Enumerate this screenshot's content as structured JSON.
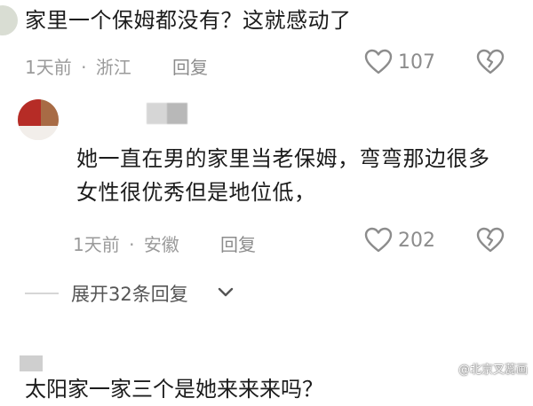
{
  "comment1": {
    "text": "家里一个保姆都没有？这就感动了",
    "time": "1天前",
    "location": "浙江",
    "reply_label": "回复",
    "likes": "107"
  },
  "comment2": {
    "text": "她一直在男的家里当老保姆，弯弯那边很多女性很优秀但是地位低，",
    "time": "1天前",
    "location": "安徽",
    "reply_label": "回复",
    "likes": "202"
  },
  "expand": {
    "label": "展开32条回复"
  },
  "next_comment": {
    "text": "太阳家一家三个是她来来来吗？"
  },
  "watermark": {
    "text": "@北京叉蕊画"
  },
  "separator": "·",
  "icons": {
    "like": "heart-icon",
    "dislike": "broken-heart-icon",
    "expand": "chevron-down-icon"
  }
}
